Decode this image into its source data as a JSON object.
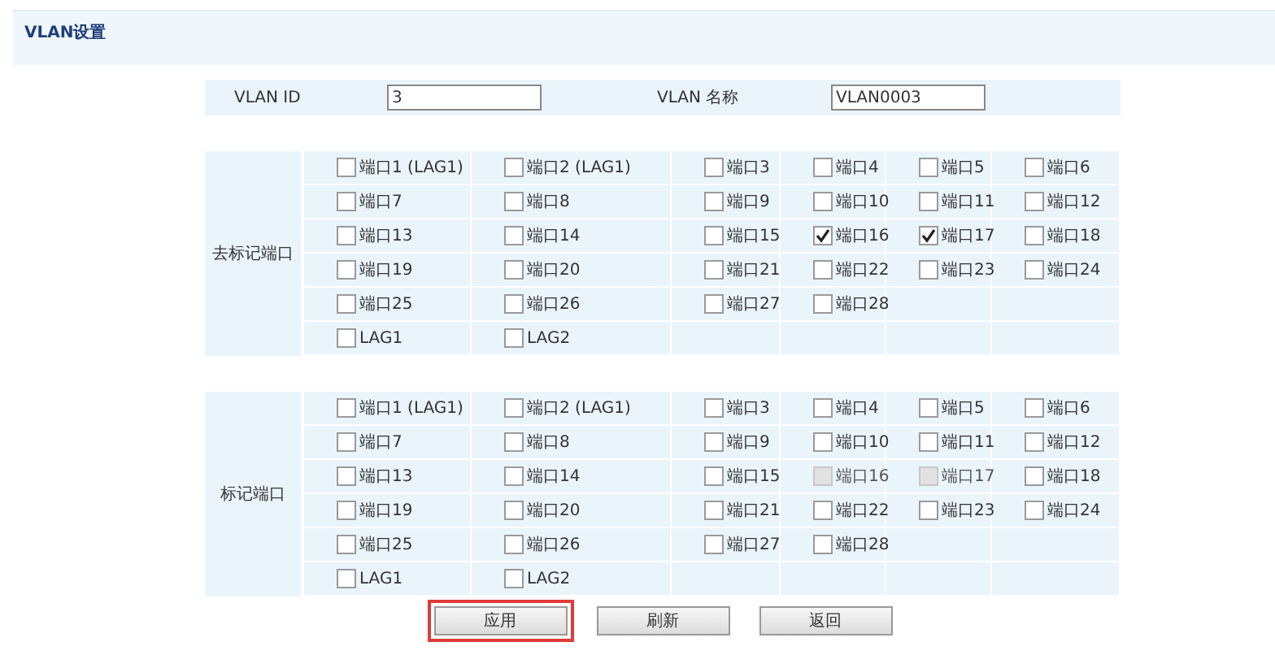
{
  "title": "VLAN设置",
  "vlan": {
    "id_label": "VLAN ID",
    "id_value": "3",
    "name_label": "VLAN 名称",
    "name_value": "VLAN0003"
  },
  "sections": [
    {
      "label": "去标记端口",
      "rows": [
        [
          {
            "label": "端口1 (LAG1)",
            "checked": false,
            "disabled": false
          },
          {
            "label": "端口2 (LAG1)",
            "checked": false,
            "disabled": false
          },
          {
            "label": "端口3",
            "checked": false,
            "disabled": false
          },
          {
            "label": "端口4",
            "checked": false,
            "disabled": false
          },
          {
            "label": "端口5",
            "checked": false,
            "disabled": false
          },
          {
            "label": "端口6",
            "checked": false,
            "disabled": false
          }
        ],
        [
          {
            "label": "端口7",
            "checked": false,
            "disabled": false
          },
          {
            "label": "端口8",
            "checked": false,
            "disabled": false
          },
          {
            "label": "端口9",
            "checked": false,
            "disabled": false
          },
          {
            "label": "端口10",
            "checked": false,
            "disabled": false
          },
          {
            "label": "端口11",
            "checked": false,
            "disabled": false
          },
          {
            "label": "端口12",
            "checked": false,
            "disabled": false
          }
        ],
        [
          {
            "label": "端口13",
            "checked": false,
            "disabled": false
          },
          {
            "label": "端口14",
            "checked": false,
            "disabled": false
          },
          {
            "label": "端口15",
            "checked": false,
            "disabled": false
          },
          {
            "label": "端口16",
            "checked": true,
            "disabled": false
          },
          {
            "label": "端口17",
            "checked": true,
            "disabled": false
          },
          {
            "label": "端口18",
            "checked": false,
            "disabled": false
          }
        ],
        [
          {
            "label": "端口19",
            "checked": false,
            "disabled": false
          },
          {
            "label": "端口20",
            "checked": false,
            "disabled": false
          },
          {
            "label": "端口21",
            "checked": false,
            "disabled": false
          },
          {
            "label": "端口22",
            "checked": false,
            "disabled": false
          },
          {
            "label": "端口23",
            "checked": false,
            "disabled": false
          },
          {
            "label": "端口24",
            "checked": false,
            "disabled": false
          }
        ],
        [
          {
            "label": "端口25",
            "checked": false,
            "disabled": false
          },
          {
            "label": "端口26",
            "checked": false,
            "disabled": false
          },
          {
            "label": "端口27",
            "checked": false,
            "disabled": false
          },
          {
            "label": "端口28",
            "checked": false,
            "disabled": false
          }
        ],
        [
          {
            "label": "LAG1",
            "checked": false,
            "disabled": false
          },
          {
            "label": "LAG2",
            "checked": false,
            "disabled": false
          }
        ]
      ]
    },
    {
      "label": "标记端口",
      "rows": [
        [
          {
            "label": "端口1 (LAG1)",
            "checked": false,
            "disabled": false
          },
          {
            "label": "端口2 (LAG1)",
            "checked": false,
            "disabled": false
          },
          {
            "label": "端口3",
            "checked": false,
            "disabled": false
          },
          {
            "label": "端口4",
            "checked": false,
            "disabled": false
          },
          {
            "label": "端口5",
            "checked": false,
            "disabled": false
          },
          {
            "label": "端口6",
            "checked": false,
            "disabled": false
          }
        ],
        [
          {
            "label": "端口7",
            "checked": false,
            "disabled": false
          },
          {
            "label": "端口8",
            "checked": false,
            "disabled": false
          },
          {
            "label": "端口9",
            "checked": false,
            "disabled": false
          },
          {
            "label": "端口10",
            "checked": false,
            "disabled": false
          },
          {
            "label": "端口11",
            "checked": false,
            "disabled": false
          },
          {
            "label": "端口12",
            "checked": false,
            "disabled": false
          }
        ],
        [
          {
            "label": "端口13",
            "checked": false,
            "disabled": false
          },
          {
            "label": "端口14",
            "checked": false,
            "disabled": false
          },
          {
            "label": "端口15",
            "checked": false,
            "disabled": false
          },
          {
            "label": "端口16",
            "checked": false,
            "disabled": true
          },
          {
            "label": "端口17",
            "checked": false,
            "disabled": true
          },
          {
            "label": "端口18",
            "checked": false,
            "disabled": false
          }
        ],
        [
          {
            "label": "端口19",
            "checked": false,
            "disabled": false
          },
          {
            "label": "端口20",
            "checked": false,
            "disabled": false
          },
          {
            "label": "端口21",
            "checked": false,
            "disabled": false
          },
          {
            "label": "端口22",
            "checked": false,
            "disabled": false
          },
          {
            "label": "端口23",
            "checked": false,
            "disabled": false
          },
          {
            "label": "端口24",
            "checked": false,
            "disabled": false
          }
        ],
        [
          {
            "label": "端口25",
            "checked": false,
            "disabled": false
          },
          {
            "label": "端口26",
            "checked": false,
            "disabled": false
          },
          {
            "label": "端口27",
            "checked": false,
            "disabled": false
          },
          {
            "label": "端口28",
            "checked": false,
            "disabled": false
          }
        ],
        [
          {
            "label": "LAG1",
            "checked": false,
            "disabled": false
          },
          {
            "label": "LAG2",
            "checked": false,
            "disabled": false
          }
        ]
      ]
    }
  ],
  "buttons": [
    {
      "label": "应用",
      "selected": true
    },
    {
      "label": "刷新",
      "selected": false
    },
    {
      "label": "返回",
      "selected": false
    }
  ]
}
